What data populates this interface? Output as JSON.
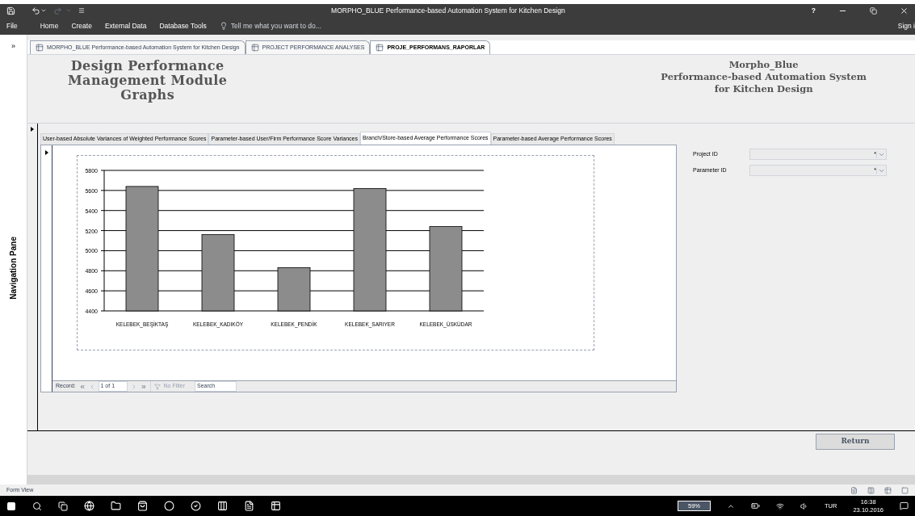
{
  "window": {
    "title": "MORPHO_BLUE Performance-based Automation System for Kitchen Design",
    "help": "?"
  },
  "ribbon": {
    "file": "File",
    "menus": [
      "Home",
      "Create",
      "External Data",
      "Database Tools"
    ],
    "tell_me": {
      "placeholder": "Tell me what you want to do..."
    },
    "sign_in": "Sign i"
  },
  "nav_toggle": "»",
  "doc_tabs": [
    {
      "label": "MORPHO_BLUE Performance-based Automation System for Kitchen Design",
      "selected": false
    },
    {
      "label": "PROJECT PERFORMANCE ANALYSES",
      "selected": false
    },
    {
      "label": "PROJE_PERFORMANS_RAPORLAR",
      "selected": true
    }
  ],
  "navigation_pane": {
    "label": "Navigation Pane"
  },
  "header": {
    "module_title": [
      "Design Performance",
      "Management Module",
      "Graphs"
    ],
    "system_title": [
      "Morpho_Blue",
      "Performance-based Automation System",
      "for Kitchen Design"
    ]
  },
  "form_tabs": [
    {
      "label": "User-based Absolute Variances of Weighted Performance Scores",
      "selected": false
    },
    {
      "label": "Parameter-based User/Firm Performance Score Variances",
      "selected": false
    },
    {
      "label": "Branch/Store-based Average Performance Scores",
      "selected": true
    },
    {
      "label": "Parameter-based Average Performance Scores",
      "selected": false
    }
  ],
  "chart_data": {
    "type": "bar",
    "categories": [
      "KELEBEK_BEŞİKTAŞ",
      "KELEBEK_KADIKÖY",
      "KELEBEK_PENDİK",
      "KELEBEK_SARIYER",
      "KELEBEK_ÜSKÜDAR"
    ],
    "values": [
      5640,
      5160,
      4830,
      5620,
      5240
    ],
    "grid": true,
    "ylim": [
      4400,
      5800
    ],
    "yticks": [
      4400,
      4600,
      4800,
      5000,
      5200,
      5400,
      5600,
      5800
    ]
  },
  "record_nav": {
    "label": "Record:",
    "position": "1 of 1",
    "filter": "No Filter",
    "search": "Search"
  },
  "filters": [
    {
      "label": "Project ID",
      "marker": "*"
    },
    {
      "label": "Parameter ID",
      "marker": "*"
    }
  ],
  "return_button": "Return",
  "status_bar": "Form View",
  "taskbar": {
    "battery": "59%",
    "language": "TUR",
    "time": "16:38",
    "date": "23.10.2016"
  }
}
